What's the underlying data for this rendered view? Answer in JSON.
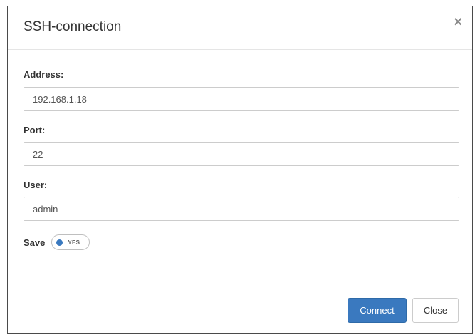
{
  "dialog": {
    "title": "SSH-connection",
    "close_glyph": "×",
    "close_icon": "close-icon"
  },
  "form": {
    "address": {
      "label": "Address:",
      "value": "192.168.1.18"
    },
    "port": {
      "label": "Port:",
      "value": "22"
    },
    "user": {
      "label": "User:",
      "value": "admin"
    },
    "save": {
      "label": "Save",
      "toggle_text": "YES",
      "checked": true
    }
  },
  "footer": {
    "connect_label": "Connect",
    "close_label": "Close"
  },
  "colors": {
    "primary": "#3a79bf",
    "border": "#cccccc",
    "text": "#333333"
  }
}
